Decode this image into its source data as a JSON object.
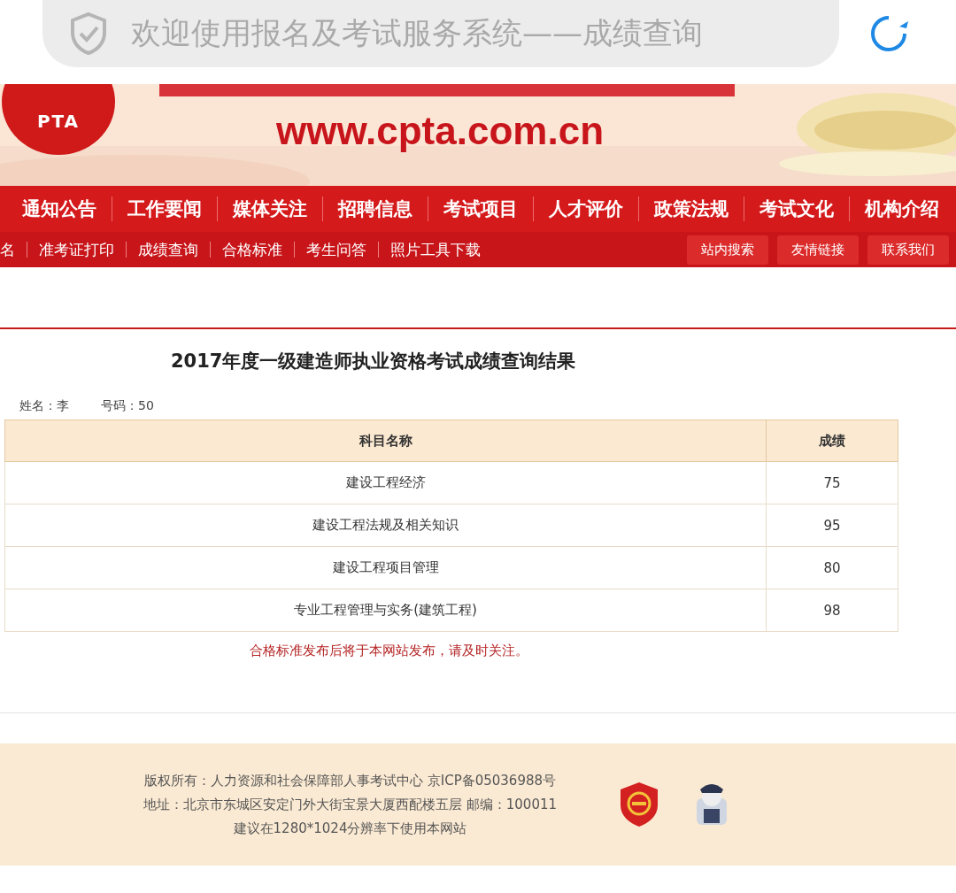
{
  "address_bar": {
    "title": "欢迎使用报名及考试服务系统——成绩查询"
  },
  "banner": {
    "logo_text": "PTA",
    "url": "www.cpta.com.cn"
  },
  "main_nav": [
    "通知公告",
    "工作要闻",
    "媒体关注",
    "招聘信息",
    "考试项目",
    "人才评价",
    "政策法规",
    "考试文化",
    "机构介绍"
  ],
  "sub_nav": [
    "名",
    "准考证打印",
    "成绩查询",
    "合格标准",
    "考生问答",
    "照片工具下载"
  ],
  "sub_nav_buttons": [
    "站内搜索",
    "友情链接",
    "联系我们"
  ],
  "result": {
    "title": "2017年度一级建造师执业资格考试成绩查询结果",
    "name_label": "姓名：李",
    "number_label": "号码：50",
    "table": {
      "columns": [
        "科目名称",
        "成绩"
      ],
      "rows": [
        {
          "subject": "建设工程经济",
          "score": "75"
        },
        {
          "subject": "建设工程法规及相关知识",
          "score": "95"
        },
        {
          "subject": "建设工程项目管理",
          "score": "80"
        },
        {
          "subject": "专业工程管理与实务(建筑工程)",
          "score": "98"
        }
      ]
    },
    "note": "合格标准发布后将于本网站发布，请及时关注。"
  },
  "footer": {
    "lines": [
      "版权所有：人力资源和社会保障部人事考试中心 京ICP备05036988号",
      "地址：北京市东城区安定门外大街宝景大厦西配楼五层 邮编：100011",
      "建议在1280*1024分辨率下使用本网站"
    ]
  }
}
